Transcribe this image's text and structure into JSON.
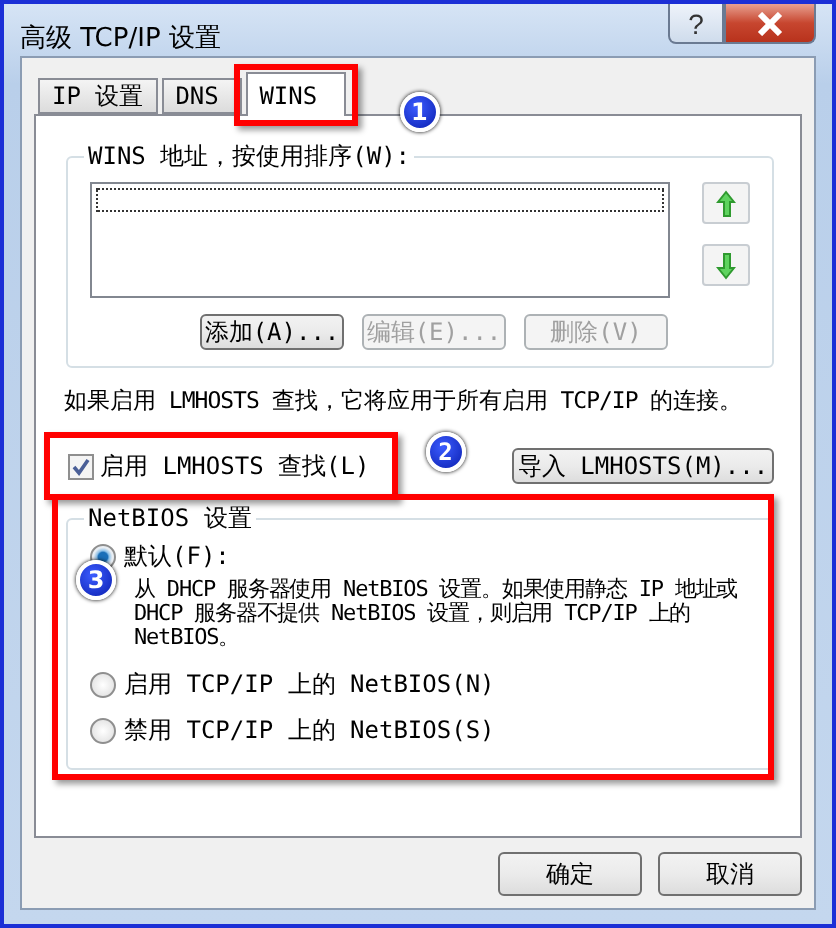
{
  "window": {
    "title": "高级 TCP/IP 设置",
    "help_label": "?"
  },
  "tabs": [
    {
      "label": "IP 设置",
      "selected": false
    },
    {
      "label": "DNS",
      "selected": false
    },
    {
      "label": "WINS",
      "selected": true
    }
  ],
  "wins_group": {
    "label": "WINS 地址，按使用排序(W):",
    "buttons": [
      {
        "label": "添加(A)...",
        "disabled": false
      },
      {
        "label": "编辑(E)...",
        "disabled": true
      },
      {
        "label": "删除(V)",
        "disabled": true
      }
    ]
  },
  "lmhosts_note": "如果启用 LMHOSTS 查找，它将应用于所有启用 TCP/IP 的连接。",
  "lmhosts_checkbox": {
    "label": "启用 LMHOSTS 查找(L)",
    "checked": true
  },
  "import_button": "导入 LMHOSTS(M)...",
  "netbios": {
    "label": "NetBIOS 设置",
    "options": [
      {
        "label": "默认(F):",
        "selected": true,
        "description": "从 DHCP 服务器使用 NetBIOS 设置。如果使用静态 IP 地址或 DHCP 服务器不提供 NetBIOS 设置，则启用 TCP/IP 上的 NetBIOS。"
      },
      {
        "label": "启用 TCP/IP 上的 NetBIOS(N)",
        "selected": false
      },
      {
        "label": "禁用 TCP/IP 上的 NetBIOS(S)",
        "selected": false
      }
    ]
  },
  "dialog_buttons": [
    "确定",
    "取消"
  ],
  "annotations": [
    {
      "number": "1",
      "kind": "tab"
    },
    {
      "number": "2",
      "kind": "checkbox"
    },
    {
      "number": "3",
      "kind": "group"
    }
  ]
}
